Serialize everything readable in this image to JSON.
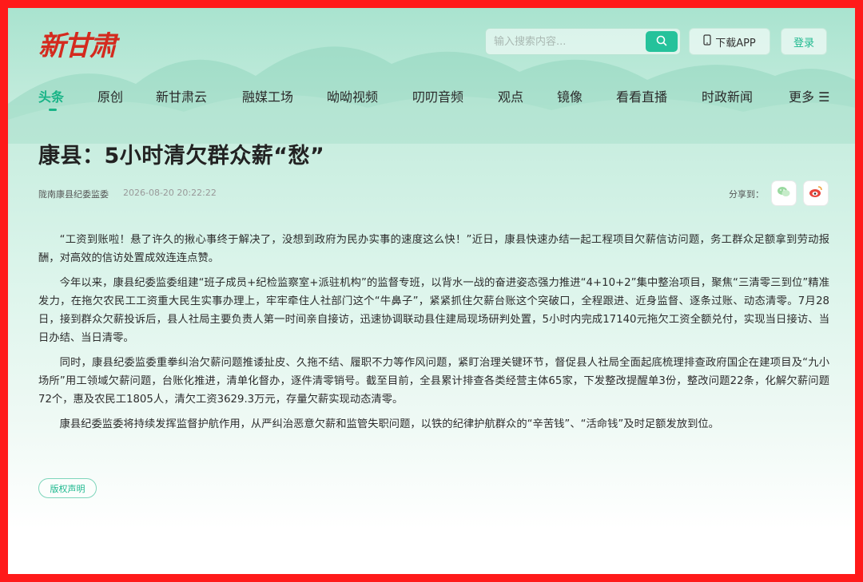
{
  "brand": {
    "logo_text": "新甘肃",
    "accent": "#19b487",
    "logo_color": "#d42a1e"
  },
  "header": {
    "search_placeholder": "输入搜索内容...",
    "search_icon": "search-icon",
    "download_label": "下载APP",
    "download_icon": "phone-icon",
    "login_label": "登录"
  },
  "nav": {
    "items": [
      {
        "label": "头条",
        "active": true
      },
      {
        "label": "原创"
      },
      {
        "label": "新甘肃云"
      },
      {
        "label": "融媒工场"
      },
      {
        "label": "呦呦视频"
      },
      {
        "label": "叨叨音频"
      },
      {
        "label": "观点"
      },
      {
        "label": "镜像"
      },
      {
        "label": "看看直播"
      },
      {
        "label": "时政新闻"
      },
      {
        "label": "更多 ☰"
      }
    ]
  },
  "article": {
    "title": "康县：5小时清欠群众薪“愁”",
    "source": "陇南康县纪委监委",
    "time": "2026-08-20 20:22:22",
    "share_label": "分享到：",
    "share_icons": [
      "wechat-icon",
      "weibo-icon"
    ],
    "paragraphs": [
      "“工资到账啦！悬了许久的揪心事终于解决了，没想到政府为民办实事的速度这么快！”近日，康县快速办结一起工程项目欠薪信访问题，务工群众足额拿到劳动报酬，对高效的信访处置成效连连点赞。",
      "今年以来，康县纪委监委组建“班子成员+纪检监察室+派驻机构”的监督专班，以背水一战的奋进姿态强力推进“4+10+2”集中整治项目，聚焦“三清零三到位”精准发力，在拖欠农民工工资重大民生实事办理上，牢牢牵住人社部门这个“牛鼻子”，紧紧抓住欠薪台账这个突破口，全程跟进、近身监督、逐条过账、动态清零。7月28日，接到群众欠薪投诉后，县人社局主要负责人第一时间亲自接访，迅速协调联动县住建局现场研判处置，5小时内完成17140元拖欠工资全额兑付，实现当日接访、当日办结、当日清零。",
      "同时，康县纪委监委重拳纠治欠薪问题推诿扯皮、久拖不结、履职不力等作风问题，紧盯治理关键环节，督促县人社局全面起底梳理排查政府国企在建项目及“九小场所”用工领域欠薪问题，台账化推进，清单化督办，逐件清零销号。截至目前，全县累计排查各类经营主体65家，下发整改提醒单3份，整改问题22条，化解欠薪问题72个，惠及农民工1805人，清欠工资3629.3万元，存量欠薪实现动态清零。",
      "康县纪委监委将持续发挥监督护航作用，从严纠治恶意欠薪和监管失职问题，以铁的纪律护航群众的“辛苦钱”、“活命钱”及时足额发放到位。"
    ],
    "copyright_label": "版权声明"
  }
}
